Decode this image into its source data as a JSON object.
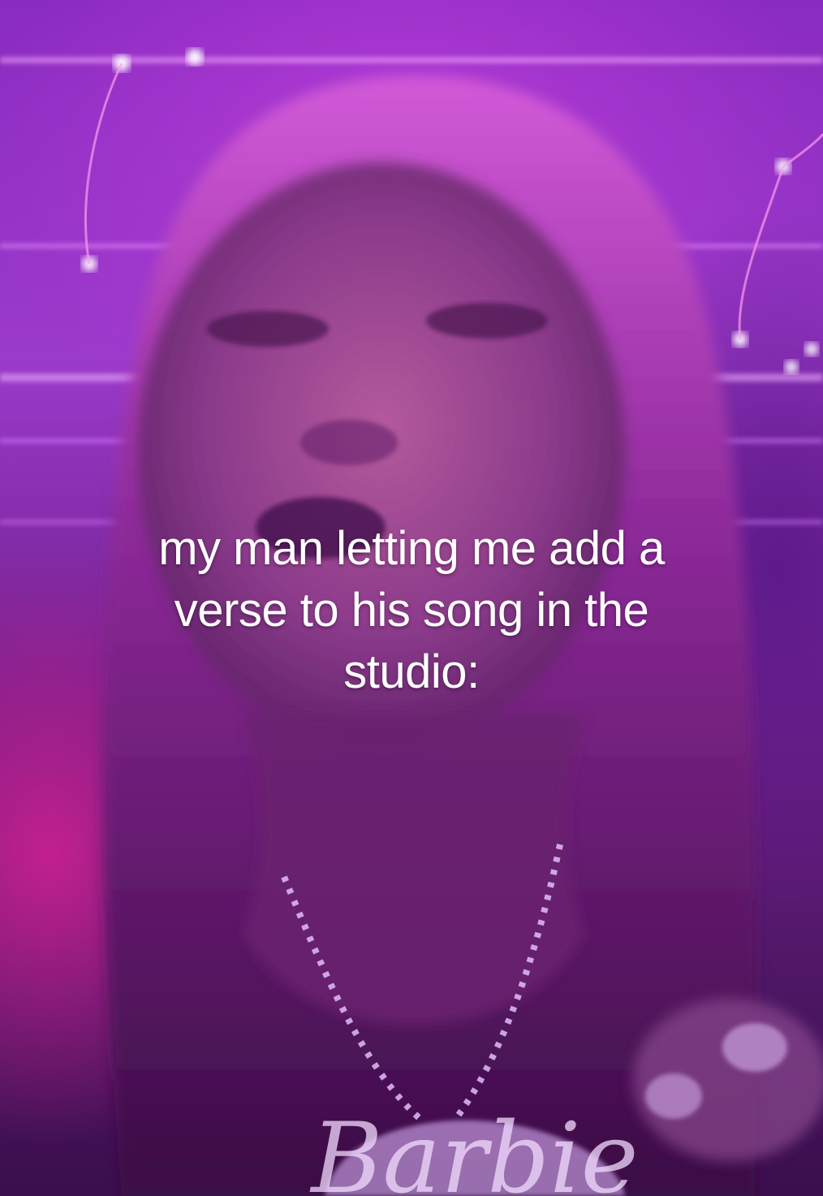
{
  "caption": {
    "line1": "my man letting me add a",
    "line2": "verse to his song in the",
    "line3": "studio:"
  },
  "pendant": {
    "text": "Barbie"
  },
  "colors": {
    "background": "#9b3acb",
    "caption_text": "#ffffff"
  }
}
